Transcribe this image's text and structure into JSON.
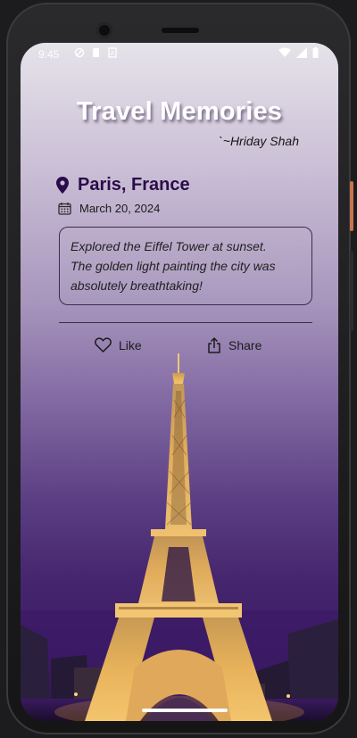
{
  "status_bar": {
    "time": "9:45"
  },
  "app": {
    "title": "Travel Memories",
    "author": "`~Hriday Shah"
  },
  "memory": {
    "location": "Paris, France",
    "date": "March 20, 2024",
    "note_line1": "Explored the Eiffel Tower at sunset.",
    "note_line2": "The golden light painting the city was",
    "note_line3": "absolutely breathtaking!"
  },
  "actions": {
    "like_label": "Like",
    "share_label": "Share"
  },
  "icons": {
    "location": "location-pin-icon",
    "date": "calendar-icon",
    "like": "heart-outline-icon",
    "share": "share-icon"
  },
  "colors": {
    "title": "#ffffff",
    "location_text": "#2a0c48",
    "gradient_top": "#e6e3ea",
    "gradient_bottom": "#36175c",
    "tower_lights": "#e8b25a"
  }
}
